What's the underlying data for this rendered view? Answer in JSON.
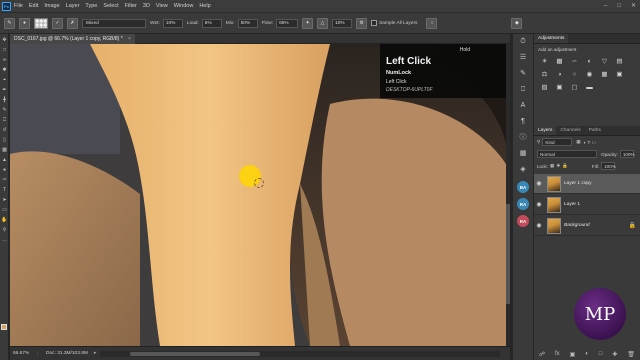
{
  "menu": {
    "logo": "Ps",
    "items": [
      "File",
      "Edit",
      "Image",
      "Layer",
      "Type",
      "Select",
      "Filter",
      "3D",
      "View",
      "Window",
      "Help"
    ]
  },
  "options": {
    "mode": "Mixed",
    "wet_label": "Wet:",
    "wet_value": "10%",
    "load_label": "Load:",
    "load_value": "5%",
    "mix_label": "Mix:",
    "mix_value": "50%",
    "flow_label": "Flow:",
    "flow_value": "65%",
    "angle_value": "10%",
    "sample_label": "Sample All Layers"
  },
  "document": {
    "tab_title": "DSC_0167.jpg @ 66.7% (Layer 1 copy, RGB/8) *",
    "zoom": "66.67%",
    "doc_info": "Doc: 31.3M/103.8M"
  },
  "overlay": {
    "hold": "Hold",
    "title": "Left Click",
    "line1": "NumLock",
    "line2": "Left Click",
    "line3": "DESKTOP-6UPLT0F"
  },
  "adjustments": {
    "tab": "Adjustments",
    "subtitle": "Add an adjustment"
  },
  "layers": {
    "tabs": [
      "Layers",
      "Channels",
      "Paths"
    ],
    "kind": "Kind",
    "blend_mode": "Normal",
    "opacity_label": "Opacity:",
    "opacity_value": "100%",
    "lock_label": "Lock:",
    "fill_label": "Fill:",
    "fill_value": "100%",
    "items": [
      {
        "name": "Layer 1 copy"
      },
      {
        "name": "Layer 1"
      },
      {
        "name": "Background"
      }
    ]
  },
  "icon_strip": {
    "badges": [
      "BA",
      "RA",
      "RA"
    ]
  },
  "watermark": "MP"
}
